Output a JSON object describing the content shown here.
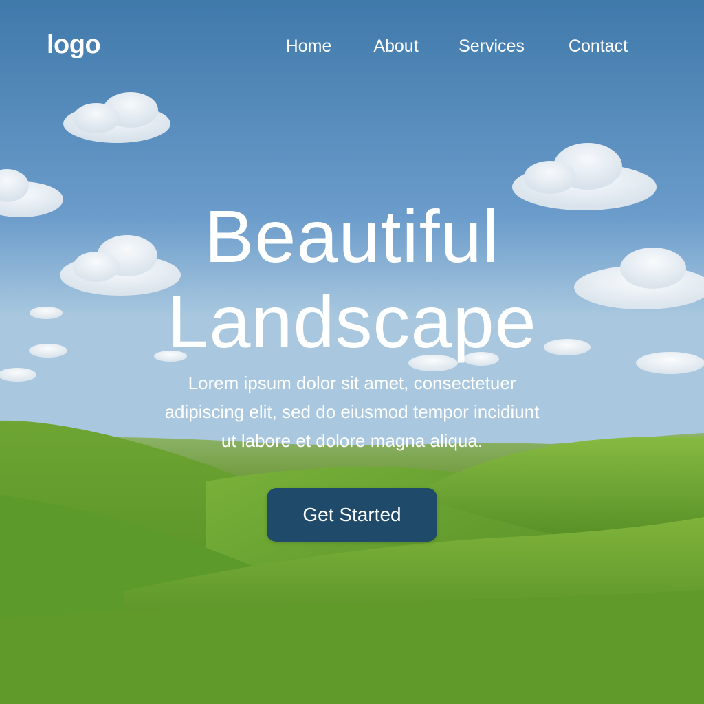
{
  "header": {
    "logo": "logo",
    "nav": [
      {
        "label": "Home"
      },
      {
        "label": "About"
      },
      {
        "label": "Services"
      },
      {
        "label": "Contact"
      }
    ]
  },
  "hero": {
    "title_lines": [
      "Beautiful",
      "Landscape"
    ],
    "text_lines": [
      "Lorem ipsum dolor sit amet, consectetuer",
      "adipiscing elit, sed do eiusmod tempor incidiunt",
      "ut labore et dolore magna aliqua."
    ],
    "cta_label": "Get Started"
  },
  "colors": {
    "sky_top": "#3f79aa",
    "sky_bottom": "#9fc3df",
    "grass_light": "#7fb33a",
    "grass_dark": "#3f7c1e",
    "button": "#1f4a6a",
    "text": "#ffffff"
  }
}
